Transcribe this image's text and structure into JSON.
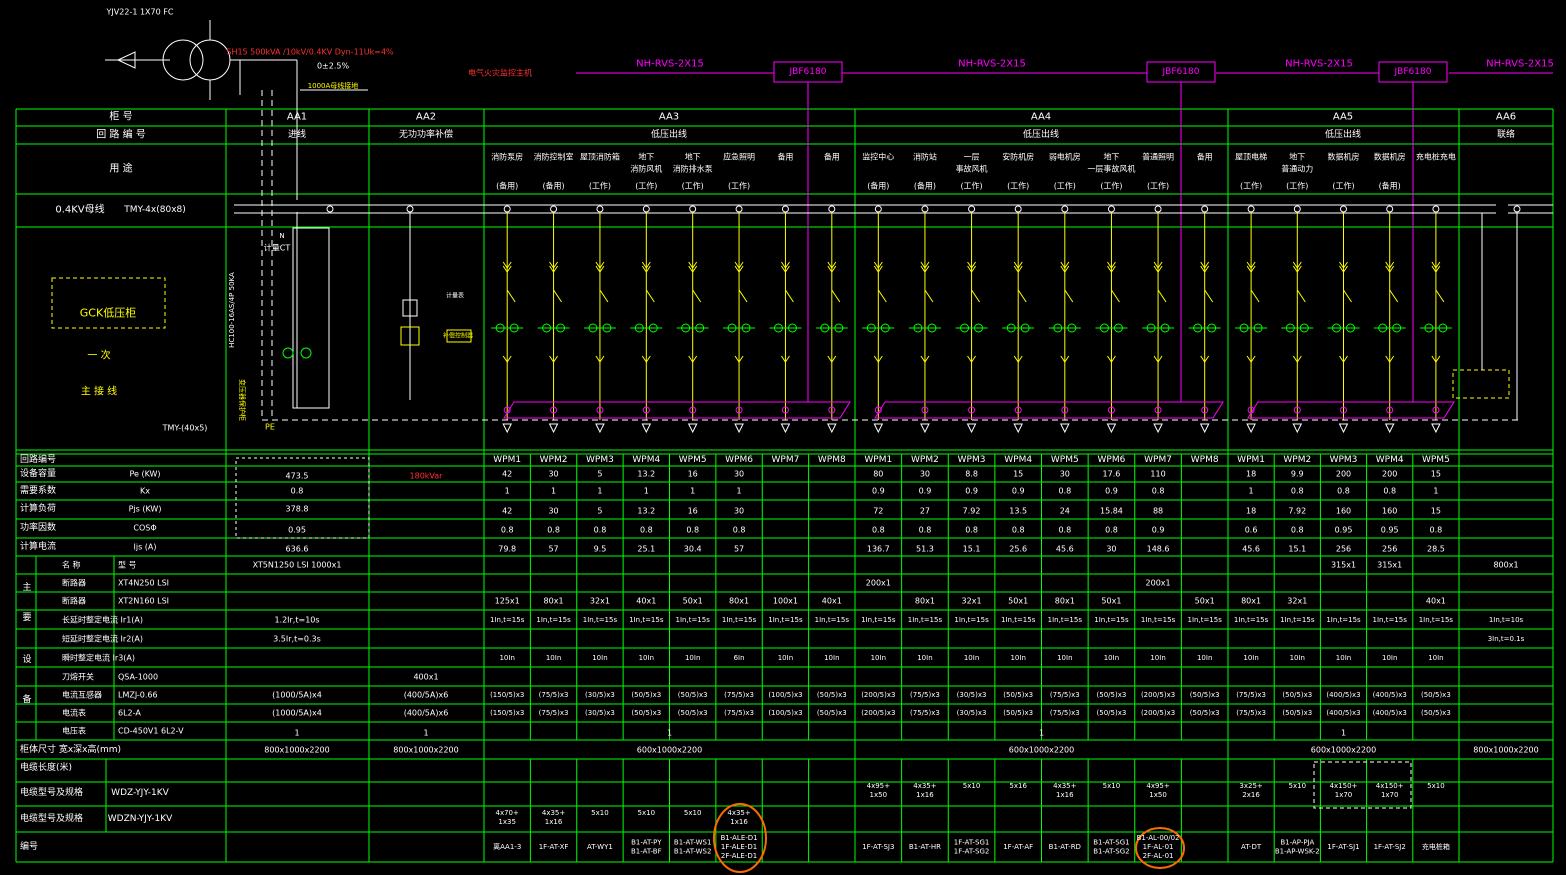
{
  "colors": {
    "background": "#000000",
    "grid": "#00ff00",
    "text": "#ffffff",
    "cable": "#ff00ff",
    "device": "#ffff00",
    "highlight": "#ff6a00",
    "transformer_note": "#ff3030"
  },
  "top": {
    "incoming_cable": "YJV22-1 1X70 FC",
    "transformer": "SH15 500kVA /10kV/0.4KV  Dyn-11Uk=4%",
    "tap_range": "0±2.5%",
    "pe_label": "1000A母线接地",
    "fire_monitor_label": "电气火灾监控主机",
    "bus_cables": [
      "NH-RVS-2X15",
      "NH-RVS-2X15",
      "NH-RVS-2X15",
      "NH-RVS-2X15"
    ],
    "monitor_boxes": [
      "JBF6180",
      "JBF6180",
      "JBF6180"
    ]
  },
  "header": {
    "row_labels": [
      "柜 号",
      "回 路 编 号",
      "用 途"
    ],
    "cabinets": [
      "AA1",
      "AA2",
      "AA3",
      "AA4",
      "AA5",
      "AA6"
    ],
    "loop_names": [
      "进线",
      "无功功率补偿",
      "低压出线",
      "低压出线",
      "低压出线",
      "联络"
    ],
    "busbar_label": "0.4KV母线",
    "busbar_spec": "TMY-4x(80x8)",
    "cabinet_type": "GCK低压柜",
    "diagram_label_1": "一 次",
    "diagram_label_2": "主 接 线",
    "pe_spec": "TMY-(40x5)",
    "pe": "PE",
    "ct_label": "计量CT",
    "surge_label": "HC100-16AS/4P 50KA",
    "meter_label": "计量表",
    "comp_label": "补偿控制器",
    "aa1_side_label": "变压器保护柜"
  },
  "uses": {
    "AA3": [
      [
        "消防泵房",
        "(备用)"
      ],
      [
        "消防控制室",
        "(备用)"
      ],
      [
        "屋顶消防箱",
        "(工作)"
      ],
      [
        "地下",
        "消防风机",
        "(工作)"
      ],
      [
        "地下",
        "消防排水泵",
        "(工作)"
      ],
      [
        "应急照明",
        "(工作)"
      ],
      [
        "备用",
        ""
      ],
      [
        "备用",
        ""
      ]
    ],
    "AA4": [
      [
        "监控中心",
        "(备用)"
      ],
      [
        "消防站",
        "(备用)"
      ],
      [
        "一层",
        "事故风机",
        "(工作)"
      ],
      [
        "安防机房",
        "(工作)"
      ],
      [
        "弱电机房",
        "(工作)"
      ],
      [
        "地下",
        "一层事故风机",
        "(工作)"
      ],
      [
        "普通照明",
        "(工作)"
      ],
      [
        "备用",
        ""
      ]
    ],
    "AA5": [
      [
        "屋顶电梯",
        "(工作)"
      ],
      [
        "地下",
        "普通动力",
        "(工作)"
      ],
      [
        "数据机房",
        "(工作)"
      ],
      [
        "数据机房",
        "(备用)"
      ],
      [
        "充电桩充电",
        ""
      ]
    ],
    "AA6": [
      [
        "联络"
      ]
    ]
  },
  "table": {
    "labels": [
      "回路编号",
      "设备容量",
      "需要系数",
      "计算负荷",
      "功率因数",
      "计算电流"
    ],
    "units": [
      "",
      "Pe (KW)",
      "Kx",
      "Pjs (KW)",
      "COSΦ",
      "Ijs (A)"
    ],
    "section_label": [
      "主",
      "要",
      "设",
      "备"
    ],
    "equip_labels": [
      "名 称",
      "断路器",
      "断路器",
      "长延时整定电流 Ir1(A)",
      "短延时整定电流 Ir2(A)",
      "瞬时整定电流 Ir3(A)",
      "刀熔开关",
      "电流互感器",
      "电流表",
      "电压表"
    ],
    "equip_models": [
      "型 号",
      "XT4N250 LSI",
      "XT2N160 LSI",
      "",
      "",
      "",
      "QSA-1000",
      "LMZJ-0.66",
      "6L2-A",
      "CD-450V1     6L2-V"
    ],
    "bottom_labels": [
      "柜体尺寸 宽x深x高(mm)",
      "电缆长度(米)",
      "电缆型号及规格",
      "电缆型号及规格",
      "编号"
    ],
    "cable_types": [
      "WDZ-YJY-1KV",
      "WDZN-YJY-1KV"
    ]
  },
  "aa1": {
    "pe": "473.5",
    "kx": "0.8",
    "pjs": "378.8",
    "cos": "0.95",
    "ijs": "636.6",
    "breaker_main": "XT5N1250  LSI   1000x1",
    "ir1": "1.2Ir,t=10s",
    "ir2": "3.5Ir,t=0.3s",
    "ct": "(1000/5A)x4",
    "am": "(1000/5A)x4",
    "vm": "1",
    "size": "800x1000x2200"
  },
  "aa2": {
    "kvar": "180kVar",
    "fuse": "400x1",
    "ct": "(400/5A)x6",
    "am": "(400/5A)x6",
    "vm": "1",
    "size": "800x1000x2200"
  },
  "aa3": {
    "wpm": [
      "WPM1",
      "WPM2",
      "WPM3",
      "WPM4",
      "WPM5",
      "WPM6",
      "WPM7",
      "WPM8"
    ],
    "pe": [
      "42",
      "30",
      "5",
      "13.2",
      "16",
      "30",
      "",
      ""
    ],
    "kx": [
      "1",
      "1",
      "1",
      "1",
      "1",
      "1",
      "",
      ""
    ],
    "pjs": [
      "42",
      "30",
      "5",
      "13.2",
      "16",
      "30",
      "",
      ""
    ],
    "cos": [
      "0.8",
      "0.8",
      "0.8",
      "0.8",
      "0.8",
      "0.8",
      "",
      ""
    ],
    "ijs": [
      "79.8",
      "57",
      "9.5",
      "25.1",
      "30.4",
      "57",
      "",
      ""
    ],
    "brk1": [
      "",
      "",
      "",
      "",
      "",
      "",
      "",
      ""
    ],
    "brk2": [
      "125x1",
      "80x1",
      "32x1",
      "40x1",
      "50x1",
      "80x1",
      "100x1",
      "40x1"
    ],
    "ir1": [
      "1In,t=15s",
      "1In,t=15s",
      "1In,t=15s",
      "1In,t=15s",
      "1In,t=15s",
      "1In,t=15s",
      "1In,t=15s",
      "1In,t=15s"
    ],
    "ir3": [
      "10In",
      "10In",
      "10In",
      "10In",
      "10In",
      "6In",
      "10In",
      "10In"
    ],
    "ct": [
      "(150/5)x3",
      "(75/5)x3",
      "(30/5)x3",
      "(50/5)x3",
      "(50/5)x3",
      "(75/5)x3",
      "(100/5)x3",
      "(50/5)x3"
    ],
    "am": [
      "(150/5)x3",
      "(75/5)x3",
      "(30/5)x3",
      "(50/5)x3",
      "(50/5)x3",
      "(75/5)x3",
      "(100/5)x3",
      "(50/5)x3"
    ],
    "vm": "1",
    "size": "600x1000x2200",
    "cable_wdzn": [
      "4x70+1x35",
      "4x35+1x16",
      "5x10",
      "5x10",
      "5x10",
      "4x35+1x16",
      "",
      ""
    ],
    "numbers": [
      [
        "离AA1-3"
      ],
      [
        "1F-AT-XF"
      ],
      [
        "AT-WY1"
      ],
      [
        "B1-AT-PY",
        "B1-AT-BF"
      ],
      [
        "B1-AT-WS1",
        "B1-AT-WS2"
      ],
      [
        "B1-ALE-D1",
        "1F-ALE-D1",
        "2F-ALE-D1"
      ],
      [
        ""
      ],
      [
        ""
      ]
    ]
  },
  "aa4": {
    "wpm": [
      "WPM1",
      "WPM2",
      "WPM3",
      "WPM4",
      "WPM5",
      "WPM6",
      "WPM7",
      "WPM8"
    ],
    "pe": [
      "80",
      "30",
      "8.8",
      "15",
      "30",
      "17.6",
      "110",
      ""
    ],
    "kx": [
      "0.9",
      "0.9",
      "0.9",
      "0.9",
      "0.8",
      "0.9",
      "0.8",
      ""
    ],
    "pjs": [
      "72",
      "27",
      "7.92",
      "13.5",
      "24",
      "15.84",
      "88",
      ""
    ],
    "cos": [
      "0.8",
      "0.8",
      "0.8",
      "0.8",
      "0.8",
      "0.8",
      "0.9",
      ""
    ],
    "ijs": [
      "136.7",
      "51.3",
      "15.1",
      "25.6",
      "45.6",
      "30",
      "148.6",
      ""
    ],
    "brk1": [
      "200x1",
      "",
      "",
      "",
      "",
      "",
      "200x1",
      ""
    ],
    "brk2": [
      "",
      "80x1",
      "32x1",
      "50x1",
      "80x1",
      "50x1",
      "",
      "50x1"
    ],
    "ir1": [
      "1In,t=15s",
      "1In,t=15s",
      "1In,t=15s",
      "1In,t=15s",
      "1In,t=15s",
      "1In,t=15s",
      "1In,t=15s",
      "1In,t=15s"
    ],
    "ir3": [
      "10In",
      "10In",
      "10In",
      "10In",
      "10In",
      "10In",
      "10In",
      "10In"
    ],
    "ct": [
      "(200/5)x3",
      "(75/5)x3",
      "(30/5)x3",
      "(50/5)x3",
      "(75/5)x3",
      "(50/5)x3",
      "(200/5)x3",
      "(50/5)x3"
    ],
    "am": [
      "(200/5)x3",
      "(75/5)x3",
      "(30/5)x3",
      "(50/5)x3",
      "(75/5)x3",
      "(50/5)x3",
      "(200/5)x3",
      "(50/5)x3"
    ],
    "vm": "1",
    "size": "600x1000x2200",
    "cable_wdz": [
      "4x95+1x50",
      "4x35+1x16",
      "5x10",
      "5x16",
      "4x35+1x16",
      "5x10",
      "4x95+1x50",
      ""
    ],
    "numbers": [
      [
        "1F-AT-SJ3"
      ],
      [
        "B1-AT-HR"
      ],
      [
        "1F-AT-SG1",
        "1F-AT-SG2"
      ],
      [
        "1F-AT-AF"
      ],
      [
        "B1-AT-RD"
      ],
      [
        "B1-AT-SG1",
        "B1-AT-SG2"
      ],
      [
        "B1-AL-00/02",
        "1F-AL-01",
        "2F-AL-01"
      ],
      [
        ""
      ]
    ]
  },
  "aa5": {
    "wpm": [
      "WPM1",
      "WPM2",
      "WPM3",
      "WPM4",
      "WPM5"
    ],
    "pe": [
      "18",
      "9.9",
      "200",
      "200",
      "15"
    ],
    "kx": [
      "1",
      "0.8",
      "0.8",
      "0.8",
      "1"
    ],
    "pjs": [
      "18",
      "7.92",
      "160",
      "160",
      "15"
    ],
    "cos": [
      "0.6",
      "0.8",
      "0.95",
      "0.95",
      "0.8"
    ],
    "ijs": [
      "45.6",
      "15.1",
      "256",
      "256",
      "28.5"
    ],
    "brk_main": [
      "",
      "",
      "315x1",
      "315x1",
      ""
    ],
    "brk2": [
      "80x1",
      "32x1",
      "",
      "",
      "40x1"
    ],
    "ir1": [
      "1In,t=15s",
      "1In,t=15s",
      "1In,t=15s",
      "1In,t=15s",
      "1In,t=15s"
    ],
    "ir3": [
      "10In",
      "10In",
      "10In",
      "10In",
      "10In"
    ],
    "ct": [
      "(75/5)x3",
      "(50/5)x3",
      "(400/5)x3",
      "(400/5)x3",
      "(50/5)x3"
    ],
    "am": [
      "(75/5)x3",
      "(50/5)x3",
      "(400/5)x3",
      "(400/5)x3",
      "(50/5)x3"
    ],
    "vm": "1",
    "size": "600x1000x2200",
    "cable_wdz": [
      "3x25+2x16",
      "5x10",
      "4x150+1x70",
      "4x150+1x70",
      "5x10"
    ],
    "numbers": [
      [
        "AT-DT"
      ],
      [
        "B1-AP-PJA",
        "B1-AP-WSK-2"
      ],
      [
        "1F-AT-SJ1"
      ],
      [
        "1F-AT-SJ2"
      ],
      [
        "充电桩箱"
      ]
    ]
  },
  "aa6": {
    "breaker": "800x1",
    "ir1": "1In,t=10s",
    "ir2": "3In,t=0.1s",
    "size": "800x1000x2200"
  }
}
